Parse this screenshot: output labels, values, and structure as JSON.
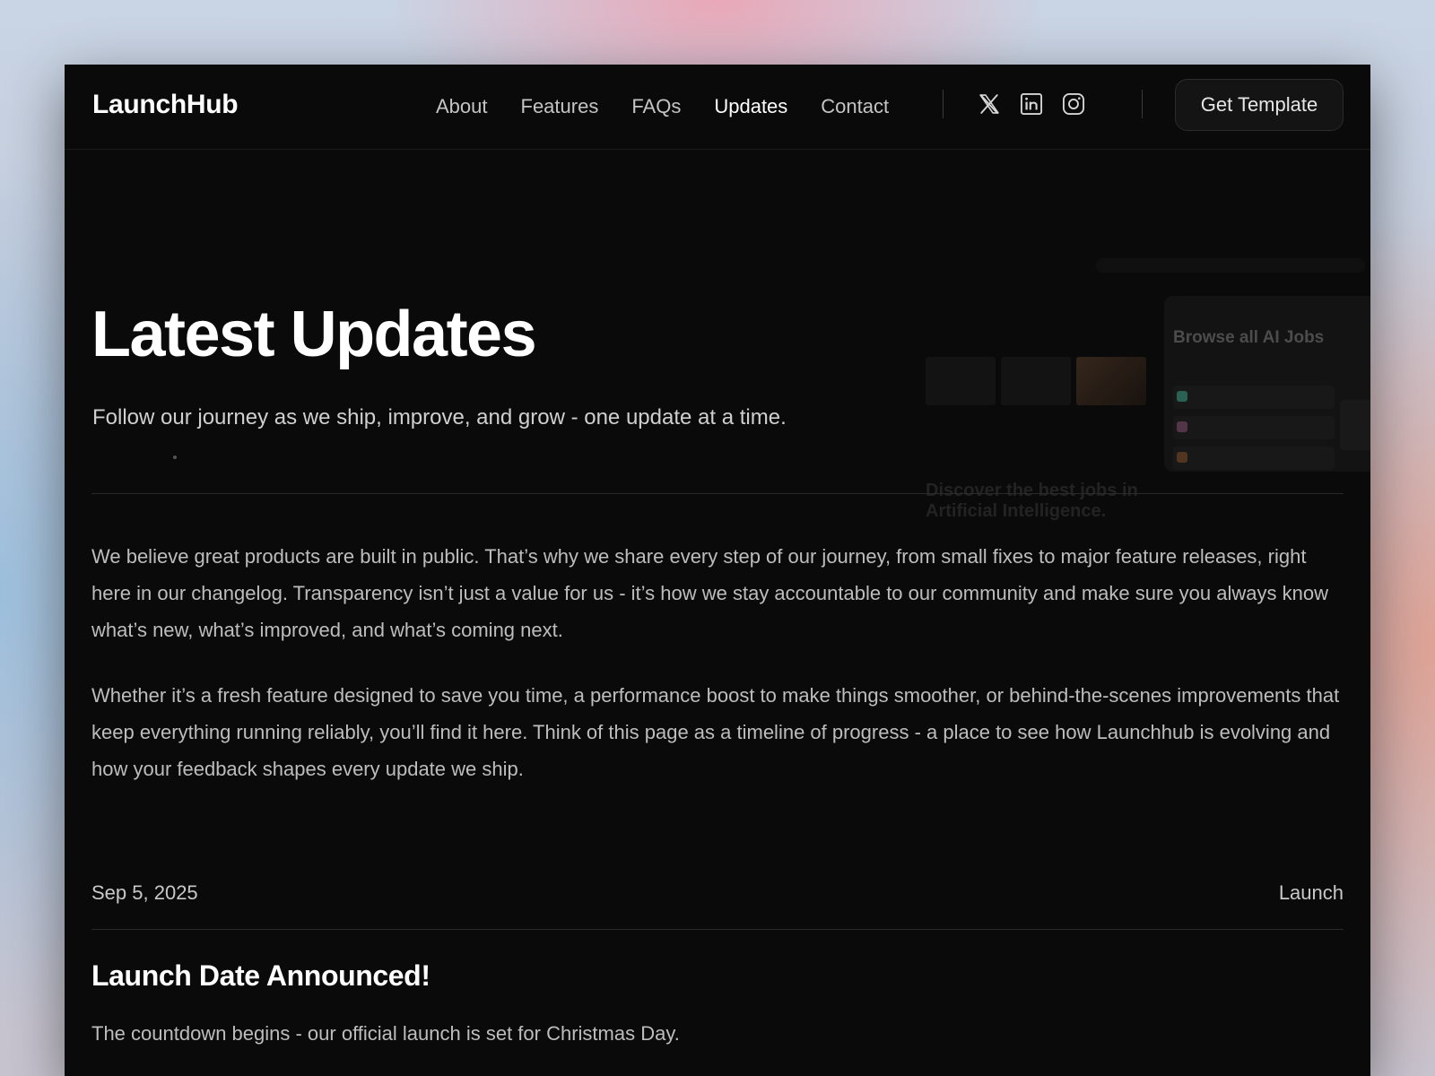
{
  "brand": {
    "name": "LaunchHub"
  },
  "nav": {
    "items": [
      {
        "label": "About",
        "active": false
      },
      {
        "label": "Features",
        "active": false
      },
      {
        "label": "FAQs",
        "active": false
      },
      {
        "label": "Updates",
        "active": true
      },
      {
        "label": "Contact",
        "active": false
      }
    ],
    "social_icons": [
      "x-icon",
      "linkedin-icon",
      "instagram-icon"
    ],
    "cta_label": "Get Template"
  },
  "hero": {
    "title": "Latest Updates",
    "subtitle": "Follow our journey as we ship, improve, and grow - one update at a time."
  },
  "preview": {
    "card_title": "Browse all AI Jobs",
    "tagline_line1": "Discover the best jobs in",
    "tagline_line2": "Artificial Intelligence."
  },
  "intro": {
    "paragraphs": [
      "We believe great products are built in public. That’s why we share every step of our journey, from small fixes to major feature releases, right here in our changelog. Transparency isn’t just a value for us - it’s how we stay accountable to our community and make sure you always know what’s new, what’s improved, and what’s coming next.",
      "Whether it’s a fresh feature designed to save you time, a performance boost to make things smoother, or behind-the-scenes improvements that keep everything running reliably, you’ll find it here. Think of this page as a timeline of progress - a place to see how Launchhub is evolving and how your feedback shapes every update we ship."
    ]
  },
  "updates": [
    {
      "date": "Sep 5, 2025",
      "tag": "Launch",
      "title": "Launch Date Announced!",
      "body": "The countdown begins - our official launch is set for Christmas Day."
    }
  ],
  "colors": {
    "page_bg": "#0a0a0a",
    "text_primary": "#ffffff",
    "text_secondary": "#bdbdbd",
    "divider": "#2a2a2a"
  }
}
